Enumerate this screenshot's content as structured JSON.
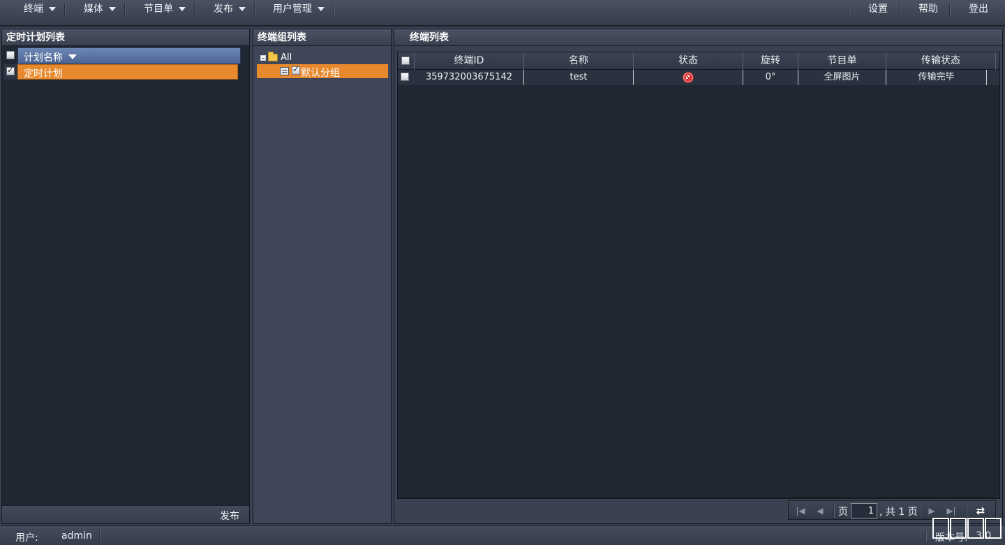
{
  "menu": {
    "left": [
      {
        "label": "终端"
      },
      {
        "label": "媒体"
      },
      {
        "label": "节目单"
      },
      {
        "label": "发布"
      },
      {
        "label": "用户管理"
      }
    ],
    "right": [
      {
        "label": "设置"
      },
      {
        "label": "帮助"
      },
      {
        "label": "登出"
      }
    ]
  },
  "plan_panel": {
    "title": "定时计划列表",
    "column_header": "计划名称",
    "rows": [
      {
        "name": "定时计划",
        "checked": true
      }
    ],
    "publish_label": "发布"
  },
  "group_panel": {
    "title": "终端组列表",
    "root_label": "All",
    "children": [
      {
        "label": "默认分组",
        "checked": true
      }
    ]
  },
  "terminal_panel": {
    "title": "终端列表",
    "columns": [
      "终端ID",
      "名称",
      "状态",
      "旋转",
      "节目单",
      "传输状态"
    ],
    "rows": [
      {
        "id": "359732003675142",
        "name": "test",
        "status_icon": "error-icon",
        "rotation": "0°",
        "playlist": "全屏图片",
        "transfer": "传输完毕"
      }
    ],
    "pager": {
      "page_label": "页",
      "current_page": "1",
      "total_label": ", 共 1 页"
    }
  },
  "statusbar": {
    "user_label": "用户:",
    "user_value": "admin",
    "version_label": "版本号:",
    "version_value": "3.0"
  },
  "colors": {
    "accent_orange": "#e8892e",
    "header_blue": "#5a74a4",
    "panel_dark": "#1f2733"
  }
}
